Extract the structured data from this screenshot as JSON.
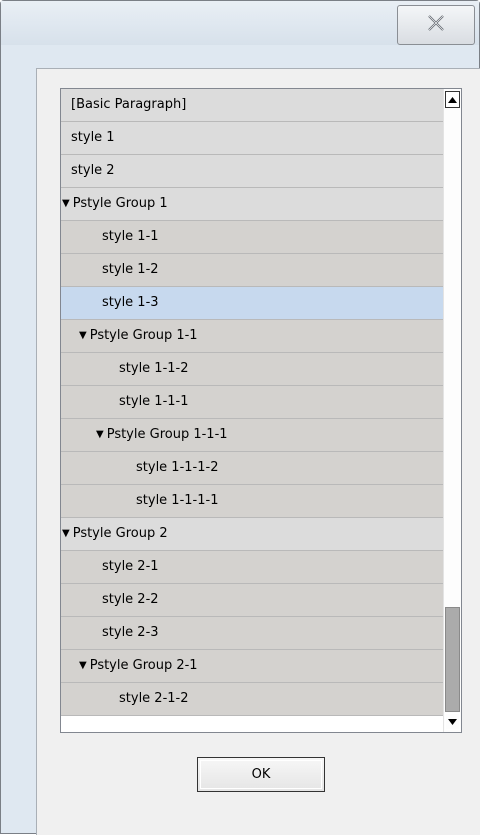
{
  "window": {
    "close_icon": "close-x-icon"
  },
  "styles_list": {
    "rows": [
      {
        "label": "[Basic Paragraph]",
        "level": 0,
        "group": false,
        "selected": false
      },
      {
        "label": "style 1",
        "level": 0,
        "group": false,
        "selected": false
      },
      {
        "label": "style 2",
        "level": 0,
        "group": false,
        "selected": false
      },
      {
        "label": "Pstyle Group 1",
        "level": 0,
        "group": true,
        "expanded": true,
        "selected": false
      },
      {
        "label": "style 1-1",
        "level": 1,
        "group": false,
        "selected": false
      },
      {
        "label": "style 1-2",
        "level": 1,
        "group": false,
        "selected": false
      },
      {
        "label": "style 1-3",
        "level": 1,
        "group": false,
        "selected": true
      },
      {
        "label": "Pstyle Group 1-1",
        "level": 1,
        "group": true,
        "expanded": true,
        "selected": false
      },
      {
        "label": "style 1-1-2",
        "level": 2,
        "group": false,
        "selected": false
      },
      {
        "label": "style 1-1-1",
        "level": 2,
        "group": false,
        "selected": false
      },
      {
        "label": "Pstyle Group 1-1-1",
        "level": 2,
        "group": true,
        "expanded": true,
        "selected": false
      },
      {
        "label": "style 1-1-1-2",
        "level": 3,
        "group": false,
        "selected": false
      },
      {
        "label": "style 1-1-1-1",
        "level": 3,
        "group": false,
        "selected": false
      },
      {
        "label": "Pstyle Group 2",
        "level": 0,
        "group": true,
        "expanded": true,
        "selected": false
      },
      {
        "label": "style 2-1",
        "level": 1,
        "group": false,
        "selected": false
      },
      {
        "label": "style 2-2",
        "level": 1,
        "group": false,
        "selected": false
      },
      {
        "label": "style 2-3",
        "level": 1,
        "group": false,
        "selected": false
      },
      {
        "label": "Pstyle Group 2-1",
        "level": 1,
        "group": true,
        "expanded": true,
        "selected": false
      },
      {
        "label": "style 2-1-2",
        "level": 2,
        "group": false,
        "selected": false
      }
    ],
    "expand_glyph": "▼",
    "scroll_position": 0.82
  },
  "footer": {
    "ok_label": "OK"
  },
  "colors": {
    "selected_row": "#c7d9ee",
    "top_level_row": "#dcdcdc",
    "nested_row": "#d4d2cf"
  }
}
